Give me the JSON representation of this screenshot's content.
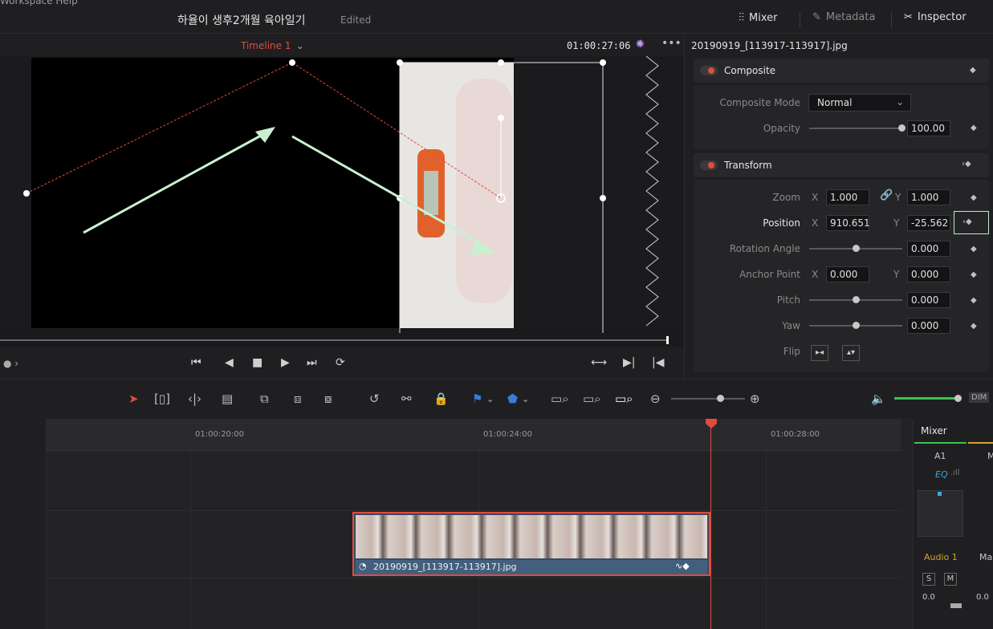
{
  "topbar": {
    "menu_text": "Workspace   Help",
    "project_title": "하율이 생후2개월 육아일기",
    "status": "Edited",
    "mixer_label": "Mixer",
    "metadata_label": "Metadata",
    "inspector_label": "Inspector"
  },
  "viewer": {
    "timeline_name": "Timeline 1",
    "timecode": "01:00:27:06"
  },
  "inspector": {
    "clip_name": "20190919_[113917-113917].jpg",
    "composite": {
      "title": "Composite",
      "mode_label": "Composite Mode",
      "mode_value": "Normal",
      "opacity_label": "Opacity",
      "opacity_value": "100.00",
      "opacity_level": 1.0
    },
    "transform": {
      "title": "Transform",
      "zoom_label": "Zoom",
      "zoom_x": "1.000",
      "zoom_y": "1.000",
      "position_label": "Position",
      "position_x": "910.651",
      "position_y": "-25.562",
      "rotation_label": "Rotation Angle",
      "rotation_value": "0.000",
      "anchor_label": "Anchor Point",
      "anchor_x": "0.000",
      "anchor_y": "0.000",
      "pitch_label": "Pitch",
      "pitch_value": "0.000",
      "yaw_label": "Yaw",
      "yaw_value": "0.000",
      "flip_label": "Flip",
      "x_label": "X",
      "y_label": "Y"
    }
  },
  "timeline": {
    "ruler": [
      "01:00:20:00",
      "01:00:24:00",
      "01:00:28:00"
    ],
    "clip_label": "20190919_[113917-113917].jpg",
    "volume_label": "DIM"
  },
  "mixer": {
    "title": "Mixer",
    "channel": "A1",
    "channel2": "M",
    "eq_label": "EQ",
    "track_name": "Audio 1",
    "track2": "Ma",
    "solo": "S",
    "mute": "M",
    "level": "0.0",
    "level2": "0.0"
  },
  "colors": {
    "accent_red": "#e24b3e",
    "clip_blue": "#42607e",
    "path_arrow": "#c8f0d0"
  }
}
